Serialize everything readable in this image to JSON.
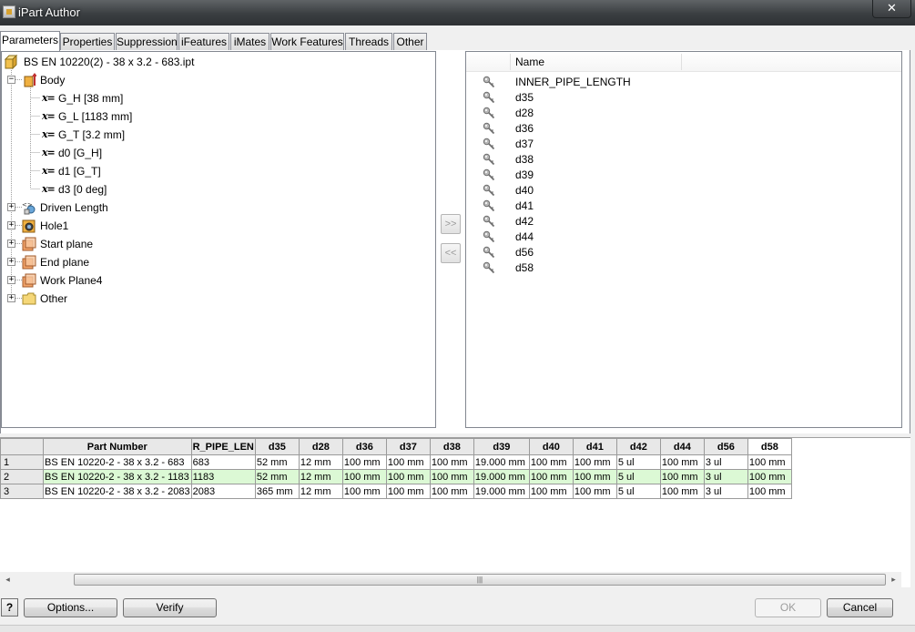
{
  "window": {
    "title": "iPart Author",
    "close_label": "✕"
  },
  "tabs": [
    {
      "label": "Parameters"
    },
    {
      "label": "Properties"
    },
    {
      "label": "Suppression"
    },
    {
      "label": "iFeatures"
    },
    {
      "label": "iMates"
    },
    {
      "label": "Work Features"
    },
    {
      "label": "Threads"
    },
    {
      "label": "Other"
    }
  ],
  "tree": {
    "root": "BS EN 10220(2) - 38 x 3.2 - 683.ipt",
    "body": "Body",
    "params": [
      "G_H [38 mm]",
      "G_L [1183 mm]",
      "G_T [3.2 mm]",
      "d0 [G_H]",
      "d1 [G_T]",
      "d3 [0 deg]"
    ],
    "param_prefix": "x=",
    "nodes": [
      "Driven Length",
      "Hole1",
      "Start plane",
      "End plane",
      "Work Plane4",
      "Other"
    ]
  },
  "transfer": {
    "add_label": ">>",
    "remove_label": "<<"
  },
  "name_list": {
    "header": "Name",
    "items": [
      "INNER_PIPE_LENGTH",
      "d35",
      "d28",
      "d36",
      "d37",
      "d38",
      "d39",
      "d40",
      "d41",
      "d42",
      "d44",
      "d56",
      "d58"
    ]
  },
  "grid": {
    "headers": [
      "",
      "Part Number",
      "R_PIPE_LEN",
      "d35",
      "d28",
      "d36",
      "d37",
      "d38",
      "d39",
      "d40",
      "d41",
      "d42",
      "d44",
      "d56",
      "d58"
    ],
    "rows": [
      [
        "1",
        "BS EN 10220-2 - 38 x 3.2 - 683",
        "683",
        "52 mm",
        "12 mm",
        "100 mm",
        "100 mm",
        "100 mm",
        "19.000 mm",
        "100 mm",
        "100 mm",
        "5 ul",
        "100 mm",
        "3 ul",
        "100 mm"
      ],
      [
        "2",
        "BS EN 10220-2 - 38 x 3.2 - 1183",
        "1183",
        "52 mm",
        "12 mm",
        "100 mm",
        "100 mm",
        "100 mm",
        "19.000 mm",
        "100 mm",
        "100 mm",
        "5 ul",
        "100 mm",
        "3 ul",
        "100 mm"
      ],
      [
        "3",
        "BS EN 10220-2 - 38 x 3.2 - 2083",
        "2083",
        "365 mm",
        "12 mm",
        "100 mm",
        "100 mm",
        "100 mm",
        "19.000 mm",
        "100 mm",
        "100 mm",
        "5 ul",
        "100 mm",
        "3 ul",
        "100 mm"
      ]
    ],
    "highlighted_row": 1,
    "highlight_color": "#dcf9d5"
  },
  "scrollbar": {
    "left_arrow": "◂",
    "right_arrow": "▸",
    "grip": "|||"
  },
  "footer": {
    "help_label": "?",
    "options_label": "Options...",
    "verify_label": "Verify",
    "ok_label": "OK",
    "cancel_label": "Cancel"
  },
  "colors": {
    "titlebar": "#3a3e41",
    "highlight_row": "#dcf9d5",
    "body_icon": "#e8a33a"
  }
}
